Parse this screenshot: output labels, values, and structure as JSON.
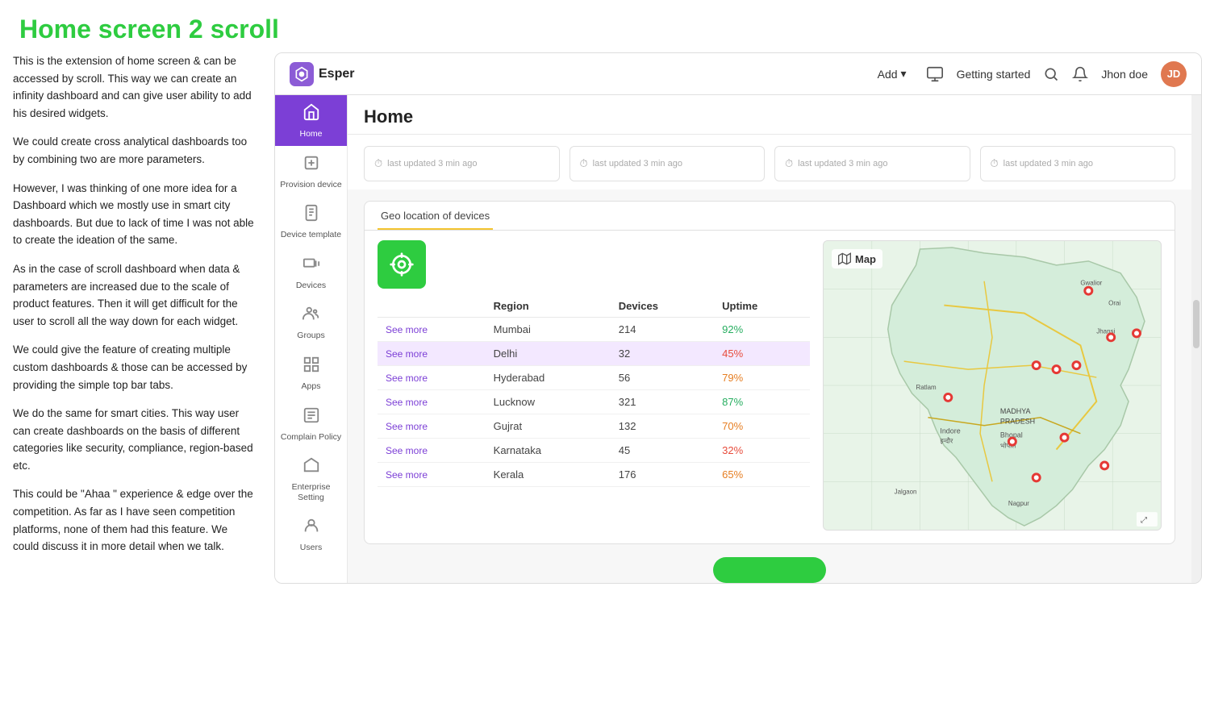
{
  "page_title": "Home screen 2 scroll",
  "left_text": [
    "This is the extension of home screen & can be accessed by scroll. This way we can create an infinity dashboard and can give user ability to add his desired widgets.",
    "We could create cross analytical dashboards too by combining two are more parameters.",
    "However, I was thinking of one more idea for a Dashboard which we mostly use in smart city dashboards. But due to lack of time I was not able to create the ideation of the same.",
    "As in the case of scroll dashboard when data & parameters are increased due to the scale of product features. Then it will get difficult for the user to scroll all the way down for each widget.",
    "We could give the feature of creating multiple custom dashboards & those can be accessed by providing the simple top bar tabs.",
    "We do the same for smart cities. This way user can create dashboards on the basis of different categories like security, compliance, region-based etc.",
    "This could be \"Ahaa \" experience & edge over the competition. As far as I have seen competition platforms, none of them had this feature. We could discuss it in more detail when we talk."
  ],
  "topbar": {
    "logo_text": "Esper",
    "add_label": "Add",
    "getting_started_label": "Getting started",
    "user_name": "Jhon doe"
  },
  "home_title": "Home",
  "stats": [
    {
      "text": "last updated 3 min ago"
    },
    {
      "text": "last updated 3 min ago"
    },
    {
      "text": "last updated 3 min ago"
    },
    {
      "text": "last updated 3 min ago"
    }
  ],
  "sidebar": {
    "items": [
      {
        "label": "Home",
        "icon": "home",
        "active": true
      },
      {
        "label": "Provision device",
        "icon": "provision",
        "active": false
      },
      {
        "label": "Device template",
        "icon": "template",
        "active": false
      },
      {
        "label": "Devices",
        "icon": "devices",
        "active": false
      },
      {
        "label": "Groups",
        "icon": "groups",
        "active": false
      },
      {
        "label": "Apps",
        "icon": "apps",
        "active": false
      },
      {
        "label": "Complain Policy",
        "icon": "policy",
        "active": false
      },
      {
        "label": "Enterprise Setting",
        "icon": "enterprise",
        "active": false
      },
      {
        "label": "Users",
        "icon": "users",
        "active": false
      }
    ]
  },
  "geo": {
    "tab_label": "Geo location of devices",
    "table_headers": [
      "Region",
      "Devices",
      "Uptime"
    ],
    "rows": [
      {
        "see_more": "See more",
        "region": "Mumbai",
        "devices": "214",
        "uptime": "92%",
        "uptime_class": "uptime-green",
        "highlight": false
      },
      {
        "see_more": "See more",
        "region": "Delhi",
        "devices": "32",
        "uptime": "45%",
        "uptime_class": "uptime-red",
        "highlight": true
      },
      {
        "see_more": "See more",
        "region": "Hyderabad",
        "devices": "56",
        "uptime": "79%",
        "uptime_class": "uptime-orange",
        "highlight": false
      },
      {
        "see_more": "See more",
        "region": "Lucknow",
        "devices": "321",
        "uptime": "87%",
        "uptime_class": "uptime-green",
        "highlight": false
      },
      {
        "see_more": "See more",
        "region": "Gujrat",
        "devices": "132",
        "uptime": "70%",
        "uptime_class": "uptime-orange",
        "highlight": false
      },
      {
        "see_more": "See more",
        "region": "Karnataka",
        "devices": "45",
        "uptime": "32%",
        "uptime_class": "uptime-red",
        "highlight": false
      },
      {
        "see_more": "See more",
        "region": "Kerala",
        "devices": "176",
        "uptime": "65%",
        "uptime_class": "uptime-orange",
        "highlight": false
      }
    ],
    "map_label": "Map"
  }
}
